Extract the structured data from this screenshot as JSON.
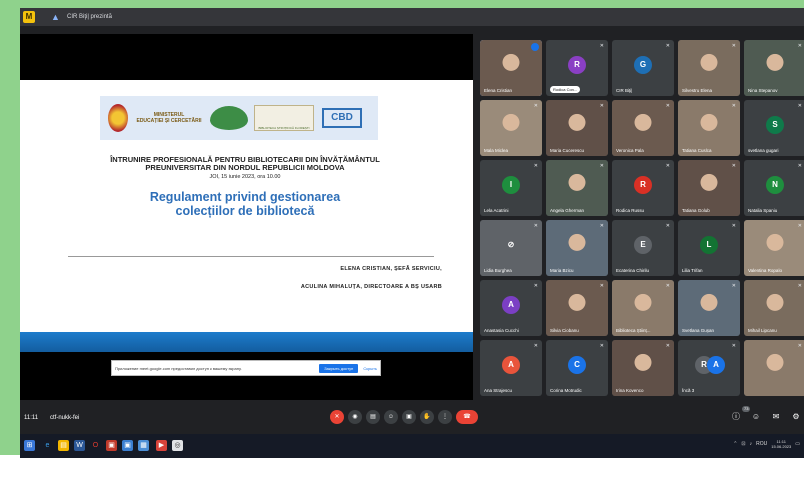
{
  "window": {
    "title": "CIR Biţi| prezintă",
    "app_icon": "meet-app-icon"
  },
  "slide": {
    "ministry": [
      "MINISTERUL",
      "EDUCAȚIEI ȘI CERCETĂRII"
    ],
    "book_caption": "BIBLIOTECA ȘTIINȚIFICĂ FLOREȘTI",
    "cbd": "CBD",
    "heading_line1": "ÎNTRUNIRE PROFESIONALĂ PENTRU BIBLIOTECARII DIN ÎNVĂȚĂMÂNTUL",
    "heading_line2": "PREUNIVERSITAR DIN NORDUL REPUBLICII MOLDOVA",
    "date": "JOI, 15 iunie 2023, ora 10.00",
    "title_line1": "Regulament privind gestionarea",
    "title_line2": "colecțiilor de bibliotecă",
    "author1": "ELENA CRISTIAN, ȘEFĂ SERVICIU,",
    "author2": "ACULINA MIHALUȚA, DIRECTOARE A BȘ USARB"
  },
  "notification": {
    "text": "Приложение meet.google.com предоставил доступ к вашему экрану.",
    "button": "Закрыть доступ",
    "link": "Скрыть"
  },
  "participants": [
    {
      "name": "Elena Cristian",
      "type": "photo",
      "active": true
    },
    {
      "name": "Rodica Con...",
      "initial": "R",
      "color": "#8a3fc4",
      "pill": true
    },
    {
      "name": "CIR Biţi|",
      "initial": "G",
      "color": "#1e6fb5"
    },
    {
      "name": "Silvestru Elena",
      "type": "photo"
    },
    {
      "name": "Nina Stepanov",
      "type": "photo"
    },
    {
      "name": "Mala Miclea",
      "type": "photo"
    },
    {
      "name": "Maria Cucerescu",
      "type": "photo"
    },
    {
      "name": "Veronica Pala",
      "type": "photo"
    },
    {
      "name": "Tatiana Cuslca",
      "type": "photo"
    },
    {
      "name": "svetlana gugari",
      "initial": "S",
      "color": "#0f7a4a"
    },
    {
      "name": "Lela Acatrini",
      "initial": "I",
      "color": "#1e8e3e"
    },
    {
      "name": "Angela Gherman",
      "type": "photo"
    },
    {
      "name": "Rodica Russu",
      "initial": "R",
      "color": "#d93025"
    },
    {
      "name": "Tatiana Golub",
      "type": "photo"
    },
    {
      "name": "Natalia Spaniu",
      "initial": "N",
      "color": "#1e8e3e"
    },
    {
      "name": "Lidia Burghea",
      "type": "dim"
    },
    {
      "name": "Maria Bzicu",
      "type": "photo"
    },
    {
      "name": "Ecaterina Chirilu",
      "initial": "E",
      "color": "#5f6368"
    },
    {
      "name": "Lilia Trifan",
      "initial": "L",
      "color": "#137333"
    },
    {
      "name": "Valentina Ropalo",
      "type": "photo"
    },
    {
      "name": "Anastasia Cucchi",
      "initial": "A",
      "color": "#7b3fc4"
    },
    {
      "name": "Silvia Ciobanu",
      "type": "photo"
    },
    {
      "name": "Biblioteca Științ...",
      "type": "photo"
    },
    {
      "name": "Svetlana Gușan",
      "type": "photo"
    },
    {
      "name": "Mihail Lipcanu",
      "type": "photo"
    },
    {
      "name": "Ana Strajescu",
      "initial": "A",
      "color": "#e8543b"
    },
    {
      "name": "Corina Motrudic",
      "initial": "C",
      "color": "#1a73e8"
    },
    {
      "name": "Irina Kovenco",
      "type": "photo"
    },
    {
      "name": "Încă 3",
      "type": "more"
    },
    {
      "name": "",
      "type": "photo"
    }
  ],
  "meet_bar": {
    "clock": "11:11",
    "meeting_code": "ctf-nukk-fei",
    "participant_count": "73"
  },
  "taskbar": {
    "tray_lang": "ROU",
    "time": "11:11",
    "date": "15.06.2023"
  },
  "colors": {
    "accent": "#1a73e8",
    "end_call": "#ea4335",
    "slide_blue": "#2e6fb8"
  }
}
